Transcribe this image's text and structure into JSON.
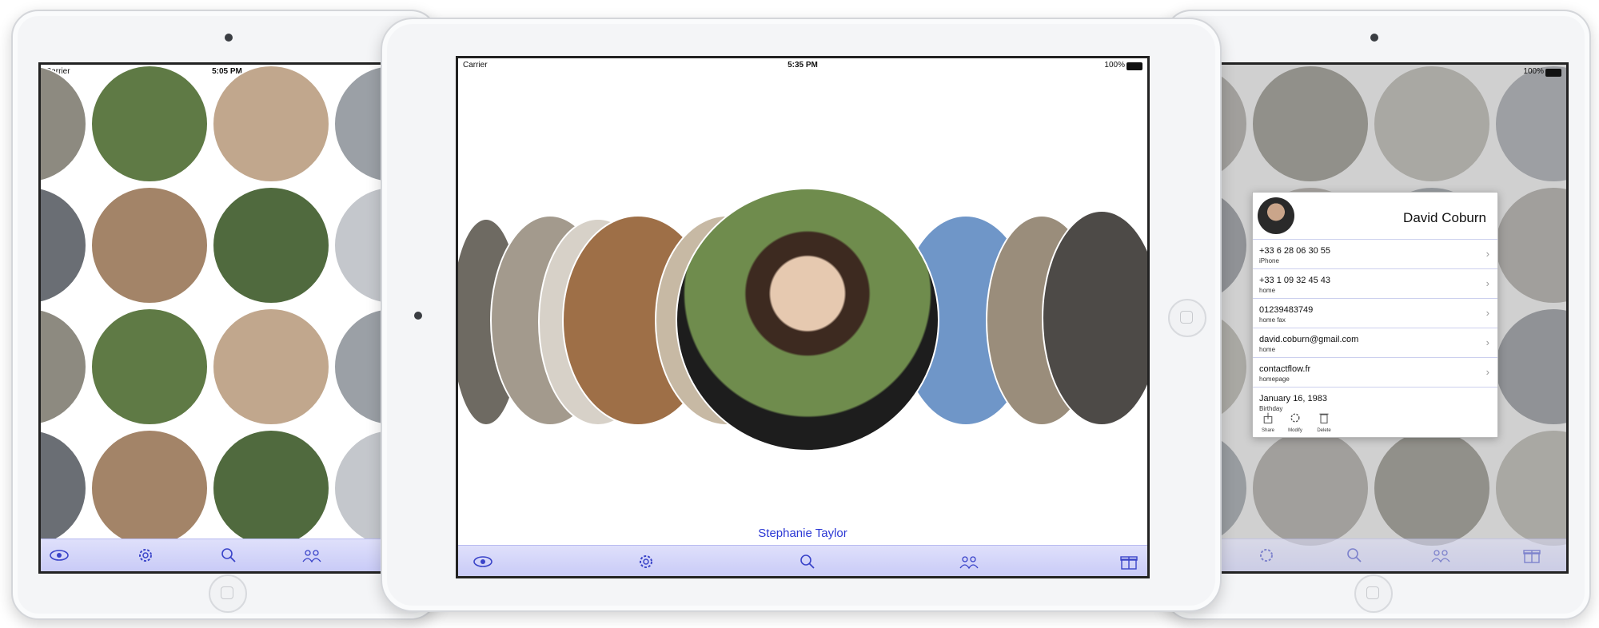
{
  "left_device": {
    "status": {
      "carrier": "Carrier",
      "time": "5:05 PM"
    },
    "tabs": [
      "eye-icon",
      "gear-icon",
      "search-icon",
      "groups-icon"
    ]
  },
  "center_device": {
    "status": {
      "carrier": "Carrier",
      "time": "5:35 PM",
      "battery": "100%"
    },
    "selected_contact": "Stephanie Taylor",
    "tabs": [
      "eye-icon",
      "gear-icon",
      "search-icon",
      "groups-icon",
      "gift-icon"
    ]
  },
  "right_device": {
    "status": {
      "battery": "100%"
    },
    "card": {
      "name": "David Coburn",
      "rows": [
        {
          "value": "+33 6 28 06 30 55",
          "label": "iPhone"
        },
        {
          "value": "+33 1 09 32 45 43",
          "label": "home"
        },
        {
          "value": "01239483749",
          "label": "home fax"
        },
        {
          "value": "david.coburn@gmail.com",
          "label": "home"
        },
        {
          "value": "contactflow.fr",
          "label": "homepage"
        },
        {
          "value": "January 16, 1983",
          "label": "Birthday"
        }
      ],
      "actions": {
        "share": "Share",
        "modify": "Modify",
        "delete": "Delete"
      }
    },
    "tabs": [
      "gear-icon",
      "search-icon",
      "groups-icon",
      "gift-icon"
    ]
  },
  "colors": {
    "accent": "#2b38d4",
    "tabbar": "#d4d6f9",
    "circle_fill": "#8a8f96"
  }
}
